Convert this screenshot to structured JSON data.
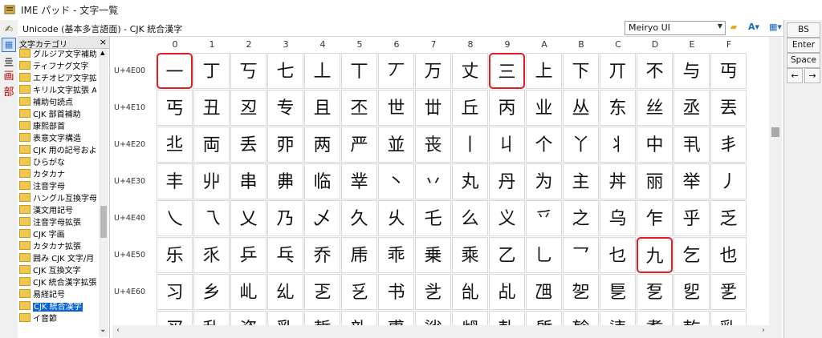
{
  "window": {
    "title": "IME パッド - 文字一覧"
  },
  "toolbar": {
    "path": "Unicode (基本多言語面) - CJK 統合漢字",
    "font": "Meiryo UI",
    "folder_icon": "folder-open-icon",
    "font_icon": "font-color-icon",
    "view_icon": "view-grid-icon"
  },
  "leftbar": {
    "strokes_label": "画",
    "radical_label": "部"
  },
  "category": {
    "header": "文字カテゴリ",
    "close": "×",
    "items": [
      "グルジア文字補助",
      "ティフナグ文字",
      "エチオピア文字拡張",
      "キリル文字拡張 A",
      "補助句読点",
      "CJK 部首補助",
      "康熙部首",
      "表意文字構造",
      "CJK 用の記号およ",
      "ひらがな",
      "カタカナ",
      "注音字母",
      "ハングル互換字母",
      "漢文用記号",
      "注音字母拡張",
      "CJK 字画",
      "カタカナ拡張",
      "囲み CJK 文字/月",
      "CJK 互換文字",
      "CJK 統合漢字拡張",
      "易経記号",
      "CJK 統合漢字",
      "イ音節"
    ],
    "selected_index": 21
  },
  "grid": {
    "columns": [
      "0",
      "1",
      "2",
      "3",
      "4",
      "5",
      "6",
      "7",
      "8",
      "9",
      "A",
      "B",
      "C",
      "D",
      "E",
      "F"
    ],
    "rows": [
      {
        "label": "U+4E00",
        "chars": [
          "一",
          "丁",
          "丂",
          "七",
          "丄",
          "丅",
          "丆",
          "万",
          "丈",
          "三",
          "上",
          "下",
          "丌",
          "不",
          "与",
          "丏"
        ]
      },
      {
        "label": "U+4E10",
        "chars": [
          "丐",
          "丑",
          "丒",
          "专",
          "且",
          "丕",
          "世",
          "丗",
          "丘",
          "丙",
          "业",
          "丛",
          "东",
          "丝",
          "丞",
          "丟"
        ]
      },
      {
        "label": "U+4E20",
        "chars": [
          "丠",
          "両",
          "丢",
          "丣",
          "两",
          "严",
          "並",
          "丧",
          "丨",
          "丩",
          "个",
          "丫",
          "丬",
          "中",
          "丮",
          "丯"
        ]
      },
      {
        "label": "U+4E30",
        "chars": [
          "丰",
          "丱",
          "串",
          "丳",
          "临",
          "丵",
          "丶",
          "丷",
          "丸",
          "丹",
          "为",
          "主",
          "丼",
          "丽",
          "举",
          "丿"
        ]
      },
      {
        "label": "U+4E40",
        "chars": [
          "乀",
          "乁",
          "乂",
          "乃",
          "乄",
          "久",
          "乆",
          "乇",
          "么",
          "义",
          "乊",
          "之",
          "乌",
          "乍",
          "乎",
          "乏"
        ]
      },
      {
        "label": "U+4E50",
        "chars": [
          "乐",
          "乑",
          "乒",
          "乓",
          "乔",
          "乕",
          "乖",
          "乗",
          "乘",
          "乙",
          "乚",
          "乛",
          "乜",
          "九",
          "乞",
          "也"
        ]
      },
      {
        "label": "U+4E60",
        "chars": [
          "习",
          "乡",
          "乢",
          "乣",
          "乤",
          "乥",
          "书",
          "乧",
          "乨",
          "乩",
          "乪",
          "乫",
          "乬",
          "乭",
          "乮",
          "乯"
        ]
      },
      {
        "label": "",
        "chars": [
          "买",
          "乱",
          "乲",
          "乳",
          "乴",
          "乵",
          "乶",
          "乷",
          "乸",
          "乹",
          "乺",
          "乻",
          "乼",
          "乽",
          "乾",
          "乿"
        ]
      }
    ],
    "highlighted": [
      "0-0",
      "0-9",
      "5-13"
    ]
  },
  "right_panel": {
    "bs": "BS",
    "enter": "Enter",
    "space": "Space",
    "left": "←",
    "right": "→"
  },
  "colors": {
    "highlight": "#e21c1c",
    "selection": "#0a64d2"
  }
}
